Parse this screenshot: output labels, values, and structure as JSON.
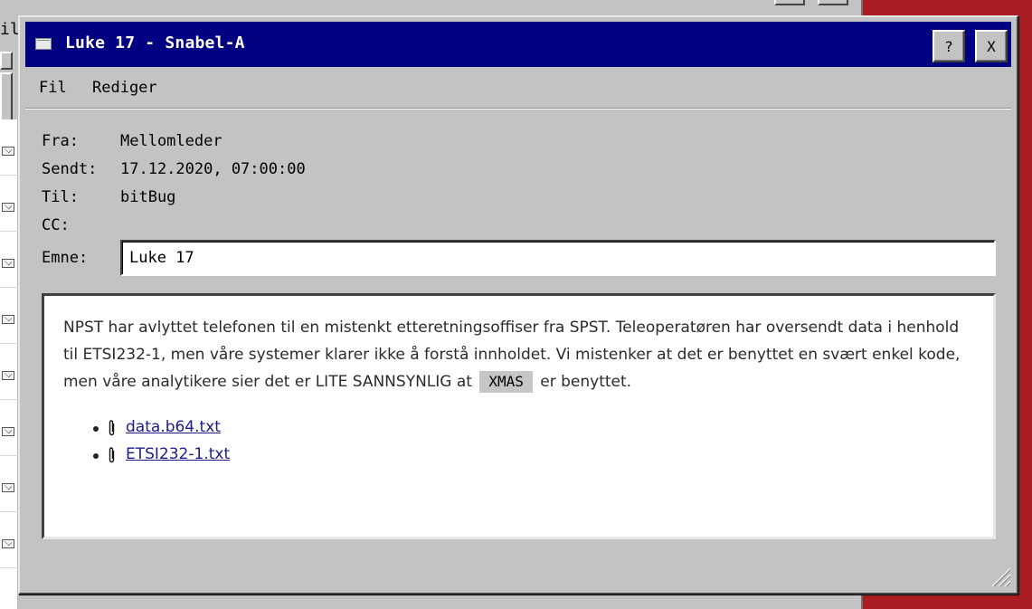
{
  "background": {
    "corner_text": "il",
    "list_row_count": 8
  },
  "window": {
    "title": "Luke 17 - Snabel-A",
    "title_icon": "envelope-icon",
    "help_button": "?",
    "close_button": "X",
    "titlebar_color": "#010081",
    "desktop_color": "#a91c22"
  },
  "menu": {
    "items": [
      "Fil",
      "Rediger"
    ]
  },
  "header": {
    "from_label": "Fra:",
    "from_value": "Mellomleder",
    "sent_label": "Sendt:",
    "sent_value": "17.12.2020, 07:00:00",
    "to_label": "Til:",
    "to_value": "bitBug",
    "cc_label": "CC:",
    "cc_value": "",
    "subject_label": "Emne:",
    "subject_value": "Luke 17"
  },
  "body": {
    "text_before": "NPST har avlyttet telefonen til en mistenkt etteretningsoffiser fra SPST. Teleoperatøren har oversendt data i henhold til ETSI232-1, men våre systemer klarer ikke å forstå innholdet. Vi mistenker at det er benyttet en svært enkel kode, men våre analytikere sier det er LITE SANNSYNLIG at",
    "code_word": "XMAS",
    "text_after": "er benyttet.",
    "attachments": [
      {
        "name": "data.b64.txt",
        "icon": "paperclip-icon"
      },
      {
        "name": "ETSI232-1.txt",
        "icon": "paperclip-icon"
      }
    ],
    "link_color": "#1e1c8a"
  }
}
